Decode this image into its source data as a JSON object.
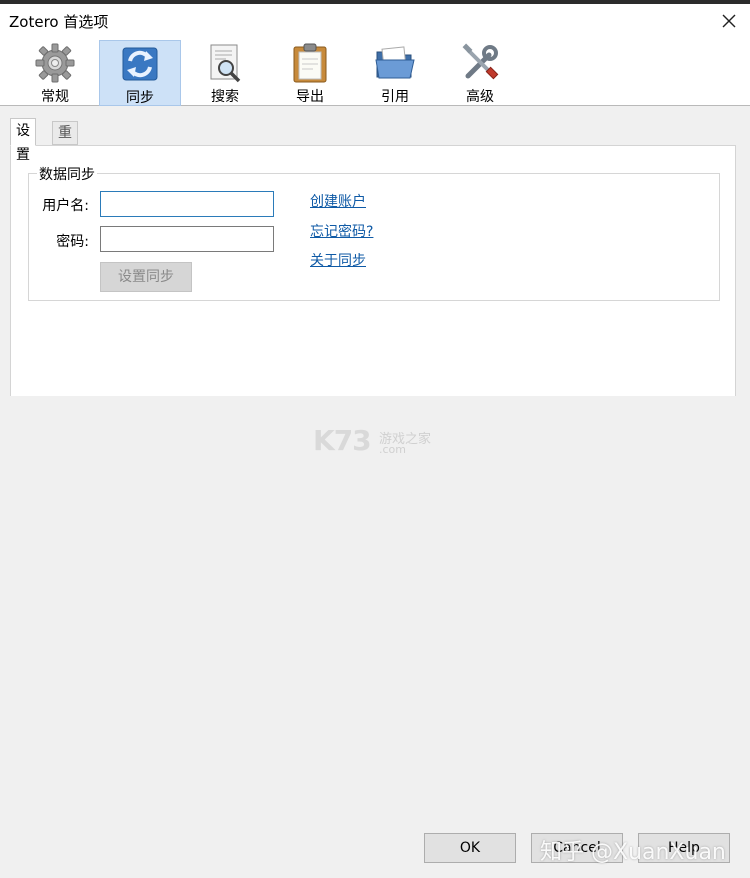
{
  "window": {
    "title": "Zotero 首选项"
  },
  "toolbar": {
    "items": [
      {
        "label": "常规",
        "icon": "gear-icon"
      },
      {
        "label": "同步",
        "icon": "sync-icon"
      },
      {
        "label": "搜索",
        "icon": "search-document-icon"
      },
      {
        "label": "导出",
        "icon": "clipboard-icon"
      },
      {
        "label": "引用",
        "icon": "folder-icon"
      },
      {
        "label": "高级",
        "icon": "tools-icon"
      }
    ],
    "active_index": 1
  },
  "tabs": [
    {
      "label": "设置",
      "selected": true
    },
    {
      "label": "重置",
      "selected": false
    }
  ],
  "sync": {
    "group_title": "数据同步",
    "username_label": "用户名:",
    "username_value": "",
    "password_label": "密码:",
    "password_value": "",
    "setup_button": "设置同步",
    "links": {
      "create_account": "创建账户",
      "forgot_password": "忘记密码?",
      "about_sync": "关于同步"
    }
  },
  "watermark": {
    "brand": "K73",
    "cn": "游戏之家",
    "com": ".com"
  },
  "buttons": {
    "ok": "OK",
    "cancel": "Cancel",
    "help": "Help"
  },
  "overlay": {
    "zhihu": "知乎 @XuanXuan"
  },
  "colors": {
    "accent": "#cde1f7",
    "link": "#0f5aa6",
    "focus": "#2b7bb9"
  }
}
